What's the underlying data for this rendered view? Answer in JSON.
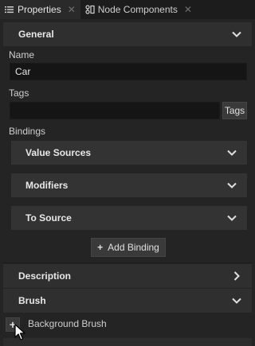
{
  "tabs": [
    {
      "label": "Properties",
      "icon": "list-icon",
      "active": true
    },
    {
      "label": "Node Components",
      "icon": "node-components-icon",
      "active": false
    }
  ],
  "general": {
    "title": "General",
    "name_label": "Name",
    "name_value": "Car",
    "tags_label": "Tags",
    "tags_value": "",
    "tags_button": "Tags",
    "bindings_label": "Bindings",
    "value_sources": "Value Sources",
    "modifiers": "Modifiers",
    "to_source": "To Source",
    "add_binding": "Add Binding",
    "add_binding_symbol": "+"
  },
  "description": {
    "title": "Description"
  },
  "brush": {
    "title": "Brush",
    "background_brush": "Background Brush",
    "add_symbol": "+"
  },
  "colors": {
    "background": "#242424",
    "header": "#2f2f2f",
    "field": "#151515"
  }
}
